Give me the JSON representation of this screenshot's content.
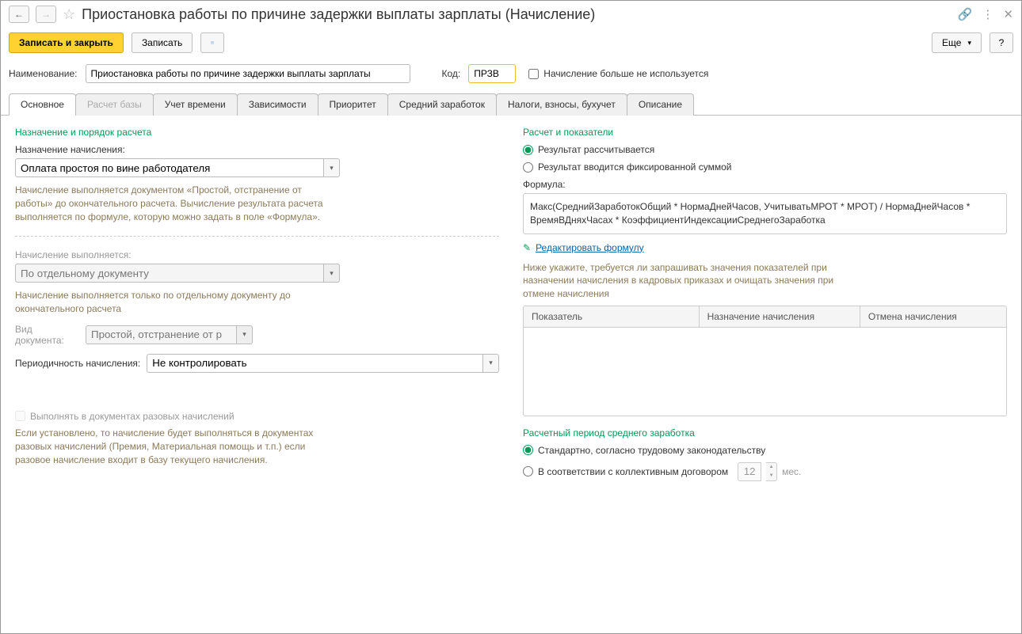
{
  "title": "Приостановка работы по причине задержки выплаты зарплаты (Начисление)",
  "toolbar": {
    "save_close": "Записать и закрыть",
    "save": "Записать",
    "more": "Еще",
    "help": "?"
  },
  "fields": {
    "name_label": "Наименование:",
    "name_value": "Приостановка работы по причине задержки выплаты зарплаты",
    "code_label": "Код:",
    "code_value": "ПРЗВ",
    "not_used_label": "Начисление больше не используется"
  },
  "tabs": {
    "t1": "Основное",
    "t2": "Расчет базы",
    "t3": "Учет времени",
    "t4": "Зависимости",
    "t5": "Приоритет",
    "t6": "Средний заработок",
    "t7": "Налоги, взносы, бухучет",
    "t8": "Описание"
  },
  "left": {
    "section1": "Назначение и порядок расчета",
    "assign_label": "Назначение начисления:",
    "assign_value": "Оплата простоя по вине работодателя",
    "hint1": "Начисление выполняется документом «Простой, отстранение от работы» до окончательного расчета. Вычисление результата расчета выполняется по формуле, которую можно задать в поле «Формула».",
    "exec_label": "Начисление выполняется:",
    "exec_value": "По отдельному документу",
    "hint2": "Начисление выполняется только по отдельному документу до окончательного расчета",
    "doc_type_label": "Вид документа:",
    "doc_type_value": "Простой, отстранение от р",
    "period_label": "Периодичность начисления:",
    "period_value": "Не контролировать",
    "oneoff_label": "Выполнять в документах разовых начислений",
    "hint3": "Если установлено, то начисление будет выполняться в документах разовых начислений (Премия, Материальная помощь и т.п.) если разовое начисление входит в базу текущего начисления."
  },
  "right": {
    "section1": "Расчет и показатели",
    "radio_calc": "Результат рассчитывается",
    "radio_fixed": "Результат вводится фиксированной суммой",
    "formula_label": "Формула:",
    "formula_value": "Макс(СреднийЗаработокОбщий * НормаДнейЧасов, УчитыватьМРОТ * МРОТ) / НормаДнейЧасов * ВремяВДняхЧасах * КоэффициентИндексацииСреднегоЗаработка",
    "edit_link": "Редактировать формулу",
    "hint1": "Ниже укажите, требуется ли запрашивать значения показателей при назначении начисления в кадровых приказах и очищать значения при отмене начисления",
    "th1": "Показатель",
    "th2": "Назначение начисления",
    "th3": "Отмена начисления",
    "section2": "Расчетный период среднего заработка",
    "radio_std": "Стандартно, согласно трудовому законодательству",
    "radio_coll": "В соответствии с коллективным договором",
    "months_value": "12",
    "months_suffix": "мес."
  }
}
